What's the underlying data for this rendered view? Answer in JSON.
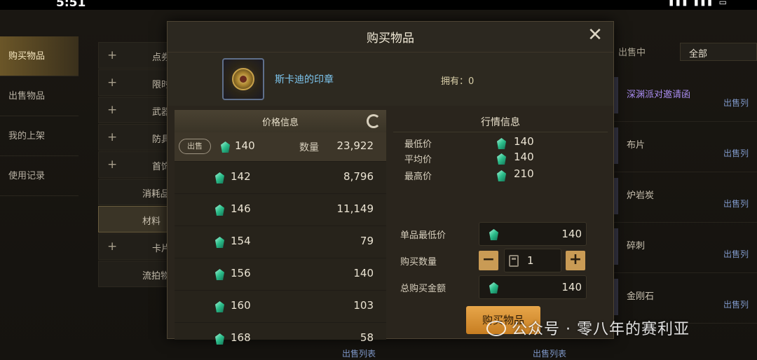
{
  "statusbar": {
    "time": "5:51"
  },
  "left_nav": [
    {
      "label": "购买物品",
      "active": true
    },
    {
      "label": "出售物品"
    },
    {
      "label": "我的上架"
    },
    {
      "label": "使用记录"
    }
  ],
  "categories": [
    {
      "label": "点券",
      "plus": true
    },
    {
      "label": "限时",
      "plus": true
    },
    {
      "label": "武器",
      "plus": true
    },
    {
      "label": "防具",
      "plus": true
    },
    {
      "label": "首饰",
      "plus": true
    },
    {
      "label": "消耗品",
      "plus": false
    },
    {
      "label": "材料",
      "plus": false,
      "selected": true
    },
    {
      "label": "卡片",
      "plus": true
    },
    {
      "label": "流拍物品",
      "plus": false
    }
  ],
  "right_panel": {
    "tab_label": "出售中",
    "filter_value": "全部",
    "rows": [
      {
        "name": "深渊派对邀请函",
        "sell_label": "出售列"
      },
      {
        "name": "布片",
        "sell_label": "出售列"
      },
      {
        "name": "炉岩炭",
        "sell_label": "出售列"
      },
      {
        "name": "碎刺",
        "sell_label": "出售列"
      },
      {
        "name": "金刚石",
        "sell_label": "出售列"
      }
    ],
    "bottom_sell_labels": [
      "出售列表",
      "出售列表"
    ]
  },
  "modal": {
    "title": "购买物品",
    "item_name": "斯卡迪的印章",
    "owned_label": "拥有：0",
    "price_info_title": "价格信息",
    "market_info_title": "行情信息",
    "sell_pill": "出售",
    "qty_label": "数量",
    "price_rows": [
      {
        "price": "140",
        "qty": "23,922"
      },
      {
        "price": "142",
        "qty": "8,796"
      },
      {
        "price": "146",
        "qty": "11,149"
      },
      {
        "price": "154",
        "qty": "79"
      },
      {
        "price": "156",
        "qty": "140"
      },
      {
        "price": "160",
        "qty": "103"
      },
      {
        "price": "168",
        "qty": "58"
      }
    ],
    "market": {
      "min_label": "最低价",
      "min_value": "140",
      "avg_label": "平均价",
      "avg_value": "140",
      "max_label": "最高价",
      "max_value": "210"
    },
    "form": {
      "unit_min_label": "单品最低价",
      "unit_min_value": "140",
      "buy_qty_label": "购买数量",
      "buy_qty_value": "1",
      "total_label": "总购买金额",
      "total_value": "140",
      "minus": "−",
      "plus": "+"
    },
    "buy_button": "购买物品"
  },
  "watermark": "公众号 · 零八年的赛利亚"
}
